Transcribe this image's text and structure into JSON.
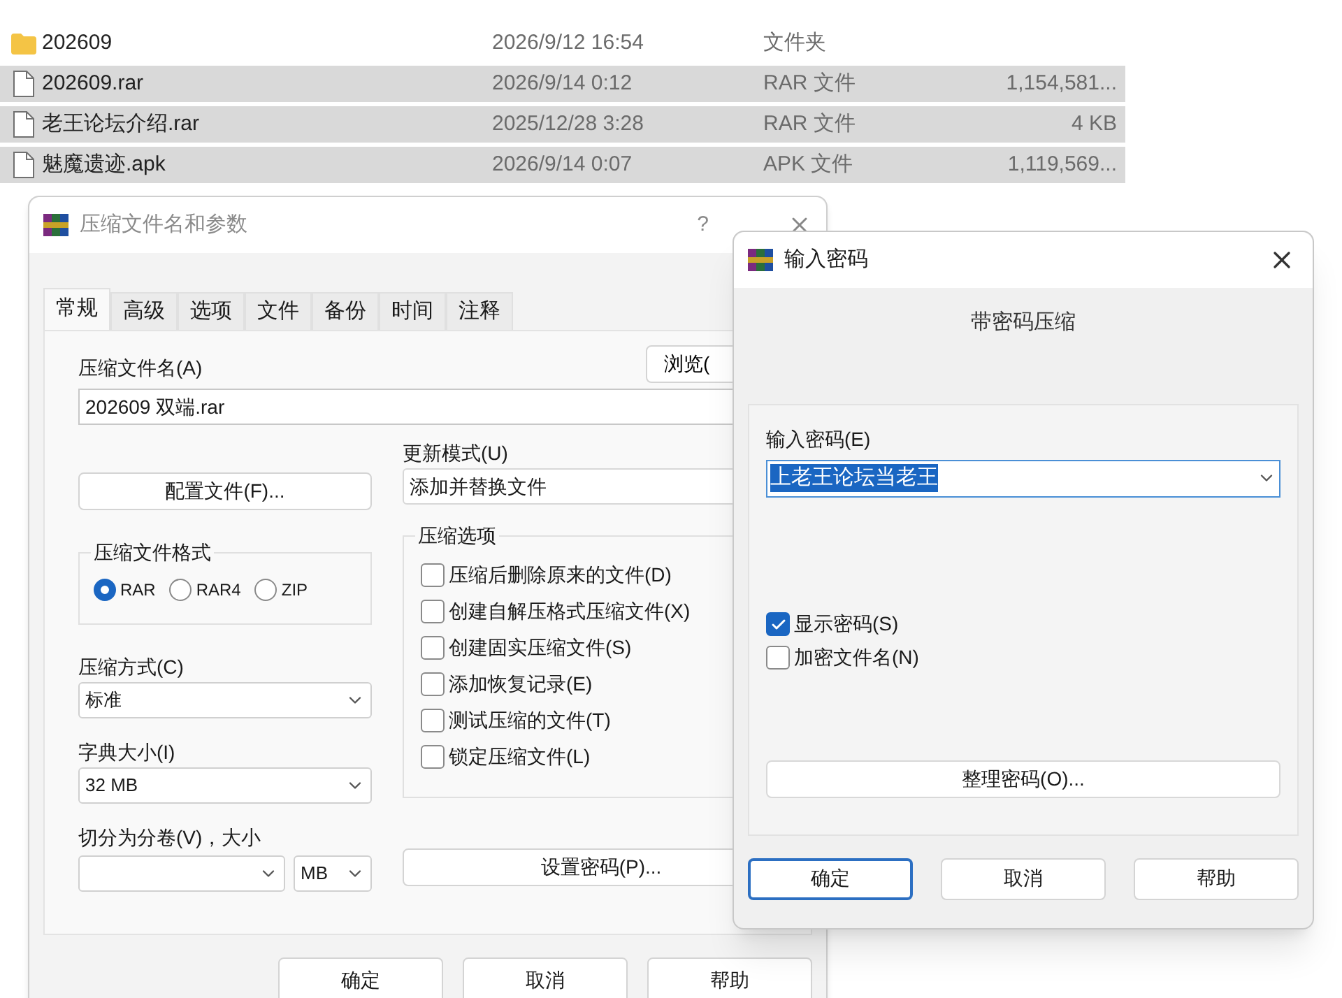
{
  "file_list": {
    "rows": [
      {
        "kind": "folder",
        "name": "202609",
        "modified": "2026/9/12 16:54",
        "type": "文件夹",
        "selected": false
      },
      {
        "kind": "file",
        "name": "202609.rar",
        "modified": "2026/9/14 0:12",
        "type": "RAR 文件",
        "size": "1,154,581...",
        "selected": true
      },
      {
        "kind": "file",
        "name": "老王论坛介绍.rar",
        "modified": "2025/12/28 3:28",
        "type": "RAR 文件",
        "size": "4 KB",
        "selected": true
      },
      {
        "kind": "file",
        "name": "魅魔遗迹.apk",
        "modified": "2026/9/14 0:07",
        "type": "APK 文件",
        "size": "1,119,569...",
        "selected": true
      }
    ]
  },
  "archive_dialog": {
    "title": "压缩文件名和参数",
    "help": "?",
    "tabs": [
      {
        "label": "常规",
        "selected": true
      },
      {
        "label": "高级",
        "selected": false
      },
      {
        "label": "选项",
        "selected": false
      },
      {
        "label": "文件",
        "selected": false
      },
      {
        "label": "备份",
        "selected": false
      },
      {
        "label": "时间",
        "selected": false
      },
      {
        "label": "注释",
        "selected": false
      }
    ],
    "archive_name_label": "压缩文件名(A)",
    "browse_button": "浏览(",
    "archive_name_value": "202609 双端.rar",
    "profiles_button": "配置文件(F)...",
    "update_mode_label": "更新模式(U)",
    "update_mode_value": "添加并替换文件",
    "format_group": {
      "title": "压缩文件格式",
      "options": [
        {
          "label": "RAR",
          "selected": true
        },
        {
          "label": "RAR4",
          "selected": false
        },
        {
          "label": "ZIP",
          "selected": false
        }
      ]
    },
    "options_group": {
      "title": "压缩选项",
      "items": [
        {
          "label": "压缩后删除原来的文件(D)",
          "checked": false
        },
        {
          "label": "创建自解压格式压缩文件(X)",
          "checked": false
        },
        {
          "label": "创建固实压缩文件(S)",
          "checked": false
        },
        {
          "label": "添加恢复记录(E)",
          "checked": false
        },
        {
          "label": "测试压缩的文件(T)",
          "checked": false
        },
        {
          "label": "锁定压缩文件(L)",
          "checked": false
        }
      ]
    },
    "method_label": "压缩方式(C)",
    "method_value": "标准",
    "dict_label": "字典大小(I)",
    "dict_value": "32 MB",
    "split_label": "切分为分卷(V)，大小",
    "split_unit": "MB",
    "set_password_button": "设置密码(P)...",
    "buttons": [
      "确定",
      "取消",
      "帮助"
    ]
  },
  "password_dialog": {
    "title": "输入密码",
    "heading": "带密码压缩",
    "password_label": "输入密码(E)",
    "password_value": "上老王论坛当老王",
    "checkboxes": [
      {
        "label": "显示密码(S)",
        "checked": true
      },
      {
        "label": "加密文件名(N)",
        "checked": false
      }
    ],
    "organize_button": "整理密码(O)...",
    "buttons": [
      {
        "label": "确定",
        "default": true
      },
      {
        "label": "取消",
        "default": false
      },
      {
        "label": "帮助",
        "default": false
      }
    ]
  }
}
